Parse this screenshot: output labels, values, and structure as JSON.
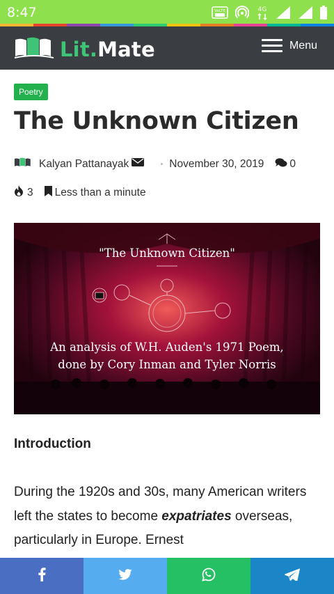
{
  "status_bar": {
    "time": "8:47",
    "volte_label": "VoLTE",
    "network_label": "4G",
    "colors": {
      "background": "#8ee04c"
    }
  },
  "rainbow_strip": [
    "#f7b733",
    "#e8432d",
    "#8e44ad",
    "#3498db",
    "#2ecc71",
    "#f1c40f",
    "#e67e22",
    "#e84393",
    "#00b894",
    "#0984e3"
  ],
  "header": {
    "logo_part1": "Lit.",
    "logo_part2": "Mate",
    "menu_label": "Menu",
    "logo_icon": "open-books-icon",
    "colors": {
      "background": "#3a3d42",
      "accent": "#3fc477"
    }
  },
  "article": {
    "category": "Poetry",
    "title": "The Unknown Citizen",
    "author": "Kalyan Pattanayak",
    "date": "November 30, 2019",
    "comments_count": "0",
    "views_count": "3",
    "read_time": "Less than a minute",
    "featured_image": {
      "title": "\"The Unknown Citizen\"",
      "caption_line1": "An analysis of W.H. Auden's 1971 Poem,",
      "caption_line2": "done by Cory Inman and Tyler Norris"
    },
    "section_heading": "Introduction",
    "paragraph_prefix": "During the 1920s and 30s, many American writers left the states to become ",
    "paragraph_emphasis": "expatriates",
    "paragraph_suffix": " overseas, particularly in Europe. Ernest"
  },
  "share_bar": [
    {
      "name": "facebook",
      "icon": "facebook-icon",
      "color": "#4a6fc2"
    },
    {
      "name": "twitter",
      "icon": "twitter-icon",
      "color": "#55acee"
    },
    {
      "name": "whatsapp",
      "icon": "whatsapp-icon",
      "color": "#25c063"
    },
    {
      "name": "telegram",
      "icon": "telegram-icon",
      "color": "#1a86c8"
    }
  ]
}
